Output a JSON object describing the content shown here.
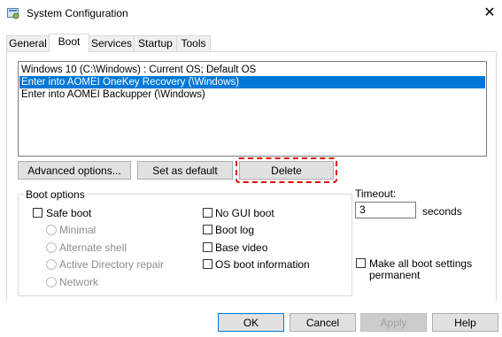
{
  "window": {
    "title": "System Configuration",
    "close_glyph": "✕",
    "icon": "msconfig-icon"
  },
  "tabs": [
    {
      "label": "General",
      "active": false
    },
    {
      "label": "Boot",
      "active": true
    },
    {
      "label": "Services",
      "active": false
    },
    {
      "label": "Startup",
      "active": false
    },
    {
      "label": "Tools",
      "active": false
    }
  ],
  "boot_entries": [
    {
      "text": "Windows 10 (C:\\Windows) : Current OS; Default OS",
      "selected": false
    },
    {
      "text": "Enter into AOMEI OneKey Recovery (\\Windows)",
      "selected": true
    },
    {
      "text": "Enter into AOMEI Backupper (\\Windows)",
      "selected": false
    }
  ],
  "buttons": {
    "advanced": "Advanced options...",
    "set_default": "Set as default",
    "delete": "Delete"
  },
  "boot_options": {
    "label": "Boot options",
    "safe_boot": {
      "label": "Safe boot",
      "checked": false
    },
    "radios": {
      "minimal": "Minimal",
      "alternate_shell": "Alternate shell",
      "ad_repair": "Active Directory repair",
      "network": "Network"
    },
    "no_gui": {
      "label": "No GUI boot",
      "checked": false
    },
    "boot_log": {
      "label": "Boot log",
      "checked": false
    },
    "base_video": {
      "label": "Base video",
      "checked": false
    },
    "os_info": {
      "label": "OS boot information",
      "checked": false
    }
  },
  "timeout": {
    "label": "Timeout:",
    "value": "3",
    "unit": "seconds"
  },
  "permanent": {
    "label_line1": "Make all boot settings",
    "label_line2": "permanent",
    "checked": false
  },
  "footer": {
    "ok": "OK",
    "cancel": "Cancel",
    "apply": "Apply",
    "help": "Help"
  },
  "colors": {
    "selection": "#0078d7",
    "highlight_border": "#e00000"
  }
}
